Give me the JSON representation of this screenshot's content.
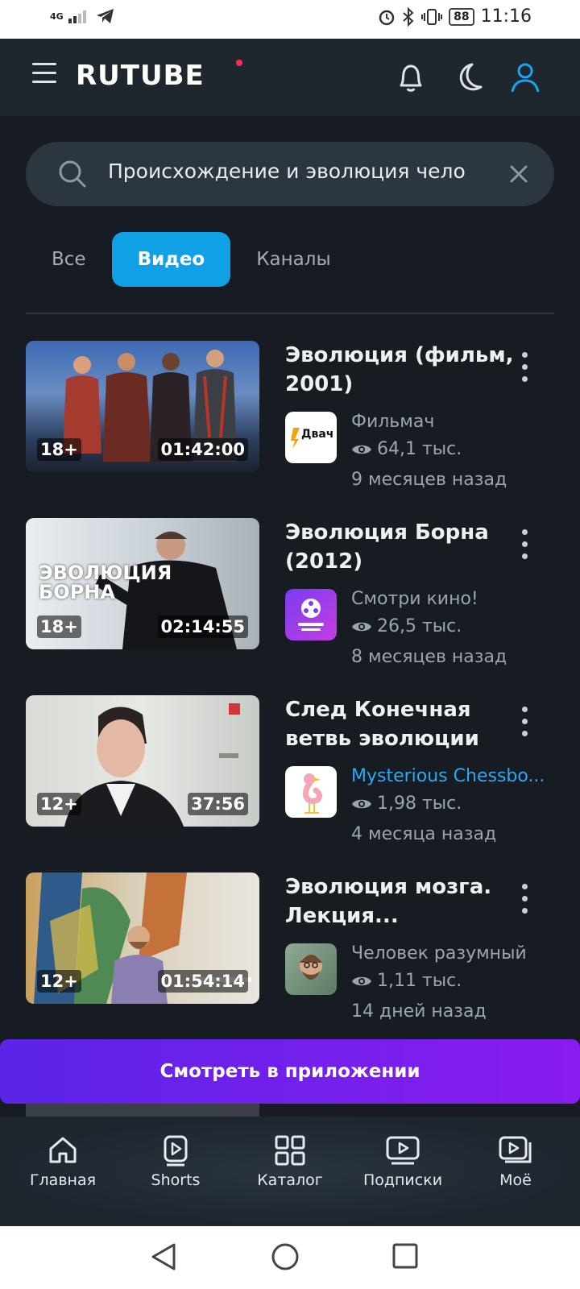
{
  "status": {
    "network": "4G",
    "time": "11:16",
    "battery": "88"
  },
  "header": {
    "logo": "RUTUBE",
    "icons": [
      "menu-icon",
      "bell-icon",
      "moon-icon",
      "user-icon"
    ]
  },
  "search": {
    "value": "Происхождение и эволюция чело",
    "icon": "search-icon",
    "clear_icon": "close-icon"
  },
  "tabs": [
    {
      "label": "Все",
      "active": false
    },
    {
      "label": "Видео",
      "active": true
    },
    {
      "label": "Каналы",
      "active": false
    }
  ],
  "results": [
    {
      "title": "Эволюция (фильм, 2001)",
      "age": "18+",
      "duration": "01:42:00",
      "channel": "Фильмач",
      "channel_avatar_text": "Двач",
      "views": "64,1 тыс.",
      "date": "9 месяцев назад"
    },
    {
      "title": "Эволюция Борна (2012)",
      "age": "18+",
      "duration": "02:14:55",
      "channel": "Смотри кино!",
      "thumb_text": "ЭВОЛЮЦИЯ БОРНА",
      "views": "26,5 тыс.",
      "date": "8 месяцев назад"
    },
    {
      "title": "След Конечная ветвь эволюции",
      "age": "12+",
      "duration": "37:56",
      "channel": "Mysterious Chessbo...",
      "views": "1,98 тыс.",
      "date": "4 месяца назад"
    },
    {
      "title": "Эволюция мозга. Лекция...",
      "age": "12+",
      "duration": "01:54:14",
      "channel": "Человек разумный",
      "views": "1,11 тыс.",
      "date": "14 дней назад"
    }
  ],
  "app_button": {
    "label": "Смотреть в приложении"
  },
  "bottom_nav": [
    {
      "label": "Главная",
      "icon": "home-icon"
    },
    {
      "label": "Shorts",
      "icon": "shorts-icon"
    },
    {
      "label": "Каталог",
      "icon": "catalog-icon"
    },
    {
      "label": "Подписки",
      "icon": "subscriptions-icon"
    },
    {
      "label": "Моё",
      "icon": "my-icon"
    }
  ],
  "colors": {
    "accent": "#10a0e6",
    "background": "#161c22",
    "app_button_start": "#5a24e6",
    "app_button_end": "#8a1cf0"
  }
}
